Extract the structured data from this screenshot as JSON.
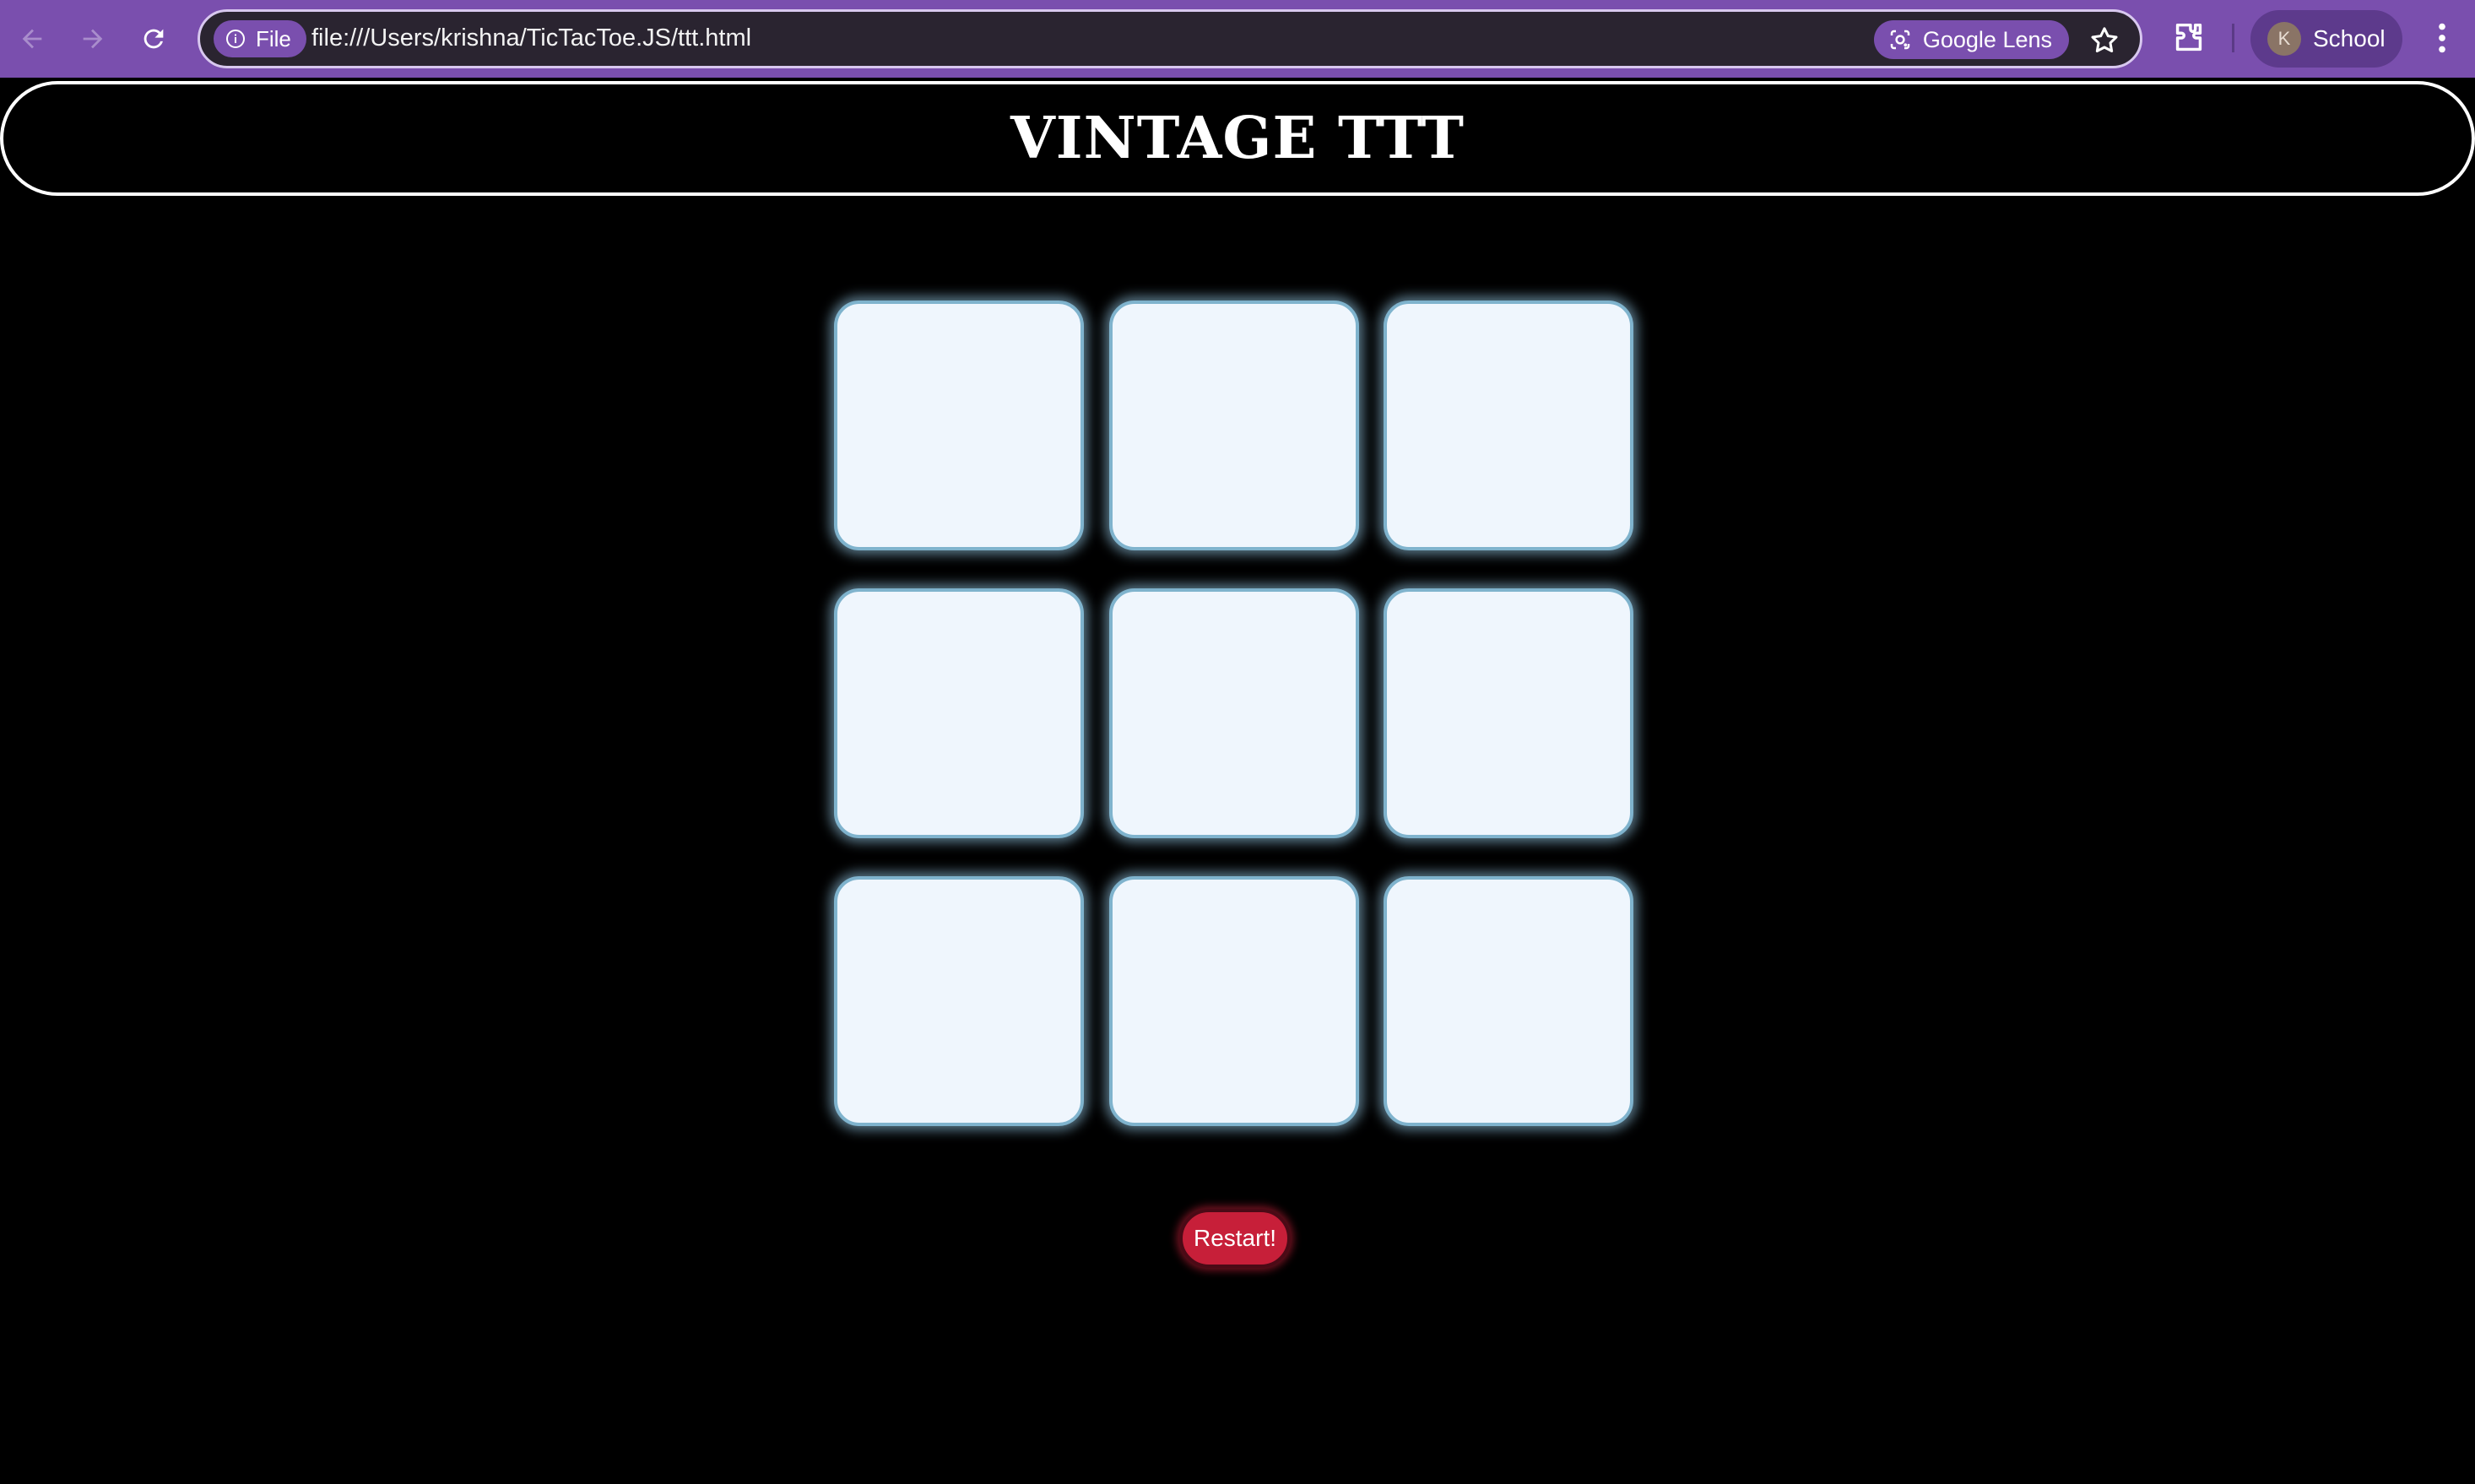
{
  "browser": {
    "file_chip_label": "File",
    "url": "file:///Users/krishna/TicTacToe.JS/ttt.html",
    "lens_label": "Google Lens",
    "profile_initial": "K",
    "profile_label": "School",
    "icons": [
      "back-arrow-icon",
      "forward-arrow-icon",
      "reload-icon",
      "info-icon",
      "lens-icon",
      "star-icon",
      "extensions-icon",
      "more-vert-icon"
    ],
    "colors": {
      "frame": "#7a4fae",
      "omnibox": "#2a2430"
    }
  },
  "page": {
    "title": "VINTAGE TTT",
    "restart_label": "Restart!",
    "board": {
      "cells": [
        "",
        "",
        "",
        "",
        "",
        "",
        "",
        "",
        ""
      ]
    },
    "colors": {
      "background": "#000000",
      "cell": "#eff6fd",
      "cell_border": "#7fb3cd",
      "restart": "#c71f39"
    }
  }
}
